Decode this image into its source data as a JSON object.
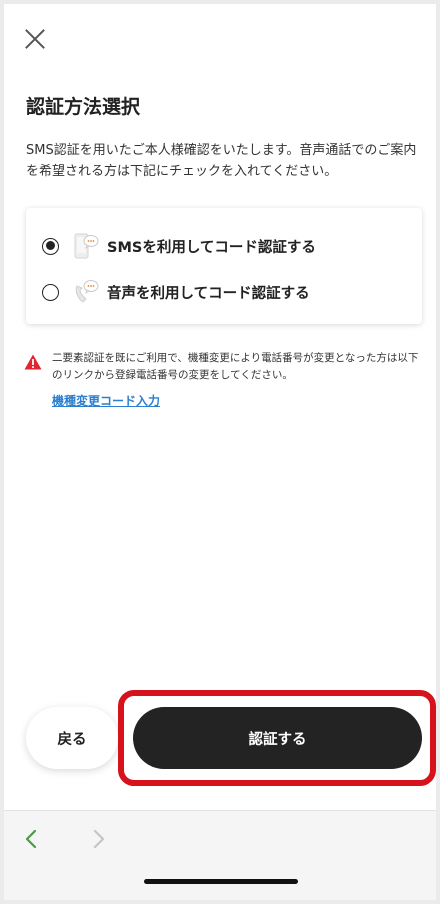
{
  "header": {
    "title": "認証方法選択"
  },
  "description": "SMS認証を用いたご本人様確認をいたします。音声通話でのご案内を希望される方は下記にチェックを入れてください。",
  "options": [
    {
      "label": "SMSを利用してコード認証する",
      "selected": true,
      "icon": "phone-message-icon"
    },
    {
      "label": "音声を利用してコード認証する",
      "selected": false,
      "icon": "handset-message-icon"
    }
  ],
  "notice": {
    "text": "二要素認証を既にご利用で、機種変更により電話番号が変更となった方は以下のリンクから登録電話番号の変更をしてください。",
    "link": "機種変更コード入力",
    "icon": "warning-icon"
  },
  "buttons": {
    "back": "戻る",
    "submit": "認証する"
  },
  "colors": {
    "primary_button": "#232323",
    "highlight": "#d6121d",
    "link": "#2c7fd0",
    "warning": "#e0262e",
    "nav_active": "#4a9a4a"
  }
}
